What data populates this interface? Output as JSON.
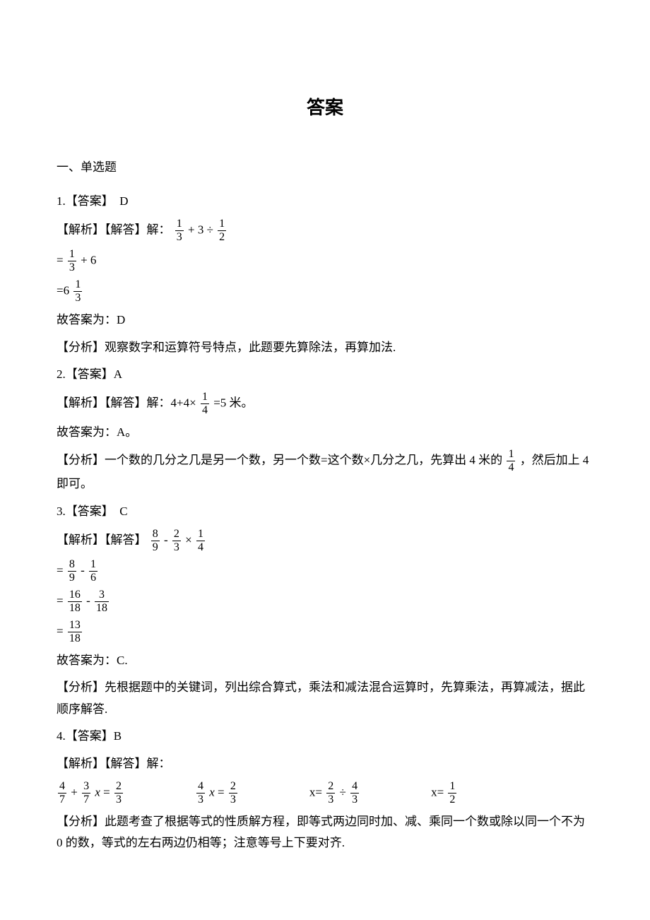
{
  "title": "答案",
  "sectionHeader": "一、单选题",
  "q1": {
    "ansLabel": "1.【答案】",
    "ansLetter": "D",
    "expLabel": "【解析】【解答】解：",
    "step2Pre": "=",
    "step2Suf": " + 6",
    "step3Pre": "=6",
    "concl": "故答案为：D",
    "analysis": "【分析】观察数字和运算符号特点，此题要先算除法，再算加法."
  },
  "q2": {
    "ansLabel": "2.【答案】A",
    "expLabel": "【解析】【解答】解：4+4×",
    "expSuffix": "=5 米。",
    "concl": "故答案为：A。",
    "analysisPre": "【分析】一个数的几分之几是另一个数，另一个数=这个数×几分之几，先算出 4 米的",
    "analysisSuf": "，然后加上 4 即可。"
  },
  "q3": {
    "ansLabel": "3.【答案】",
    "ansLetter": "C",
    "expLabel": "【解析】【解答】",
    "concl": "故答案为：C.",
    "analysis": "【分析】先根据题中的关键词，列出综合算式，乘法和减法混合运算时，先算乘法，再算减法，据此顺序解答."
  },
  "q4": {
    "ansLabel": "4.【答案】B",
    "expLabel": "【解析】【解答】解：",
    "analysis": "【分析】此题考查了根据等式的性质解方程，即等式两边同时加、减、乘同一个数或除以同一个不为 0 的数，等式的左右两边仍相等；注意等号上下要对齐."
  },
  "plus": " + ",
  "minus": " - ",
  "times": "×",
  "div": " ÷ ",
  "eq": " = ",
  "xPrefix": "x=",
  "xVar": "x"
}
